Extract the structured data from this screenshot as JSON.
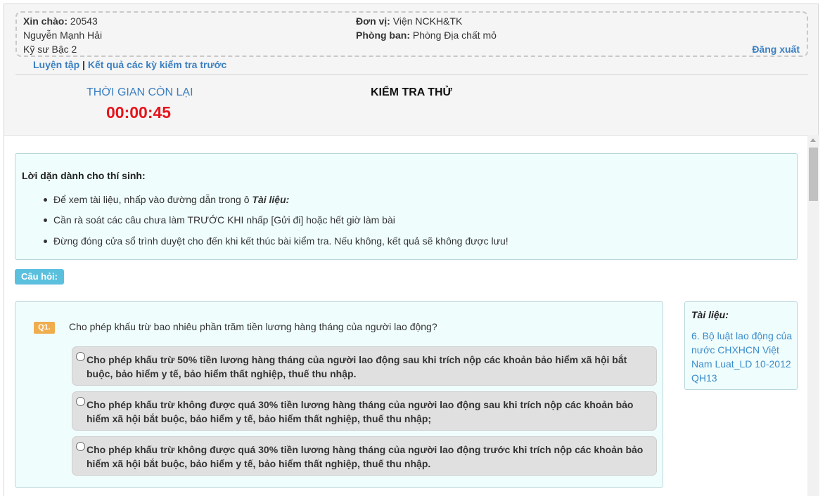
{
  "user": {
    "greeting_label": "Xin chào:",
    "user_id": "20543",
    "full_name": "Nguyễn Mạnh Hải",
    "rank": "Kỹ sư Bậc 2",
    "unit_label": "Đơn vị:",
    "unit_value": "Viện NCKH&TK",
    "department_label": "Phòng ban:",
    "department_value": "Phòng Địa chất mỏ",
    "logout_label": "Đăng xuất"
  },
  "nav": {
    "practice_label": "Luyện tập",
    "separator": "|",
    "results_label": "Kết quả các kỳ kiểm tra trước"
  },
  "timer": {
    "label": "THỜI GIAN CÒN LẠI",
    "value": "00:00:45"
  },
  "exam": {
    "title": "KIỂM TRA THỬ"
  },
  "notice": {
    "title": "Lời dặn dành cho thí sinh:",
    "item1_prefix": "Để xem tài liệu, nhấp vào đường dẫn trong ô ",
    "item1_emphasis": "Tài liệu:",
    "item2": "Cần rà soát các câu chưa làm TRƯỚC KHI nhấp [Gửi đi] hoặc hết giờ làm bài",
    "item3": "Đừng đóng cửa sổ trình duyệt cho đến khi kết thúc bài kiểm tra. Nếu không, kết quả sẽ không được lưu!"
  },
  "questions_label": "Câu hỏi:",
  "question": {
    "number": "Q1.",
    "text": "Cho phép khấu trừ bao nhiêu phần trăm tiền lương hàng tháng của người lao động?",
    "options": [
      "Cho phép khấu trừ 50% tiền lương hàng tháng của người lao động sau khi trích nộp các khoản bảo hiểm xã hội bắt buộc, bảo hiểm y tế, bảo hiểm thất nghiệp, thuế thu nhập.",
      "Cho phép khấu trừ không được quá 30% tiền lương hàng tháng của người lao động sau khi trích nộp các khoản bảo hiểm xã hội bắt buộc, bảo hiểm y tế, bảo hiểm thất nghiệp, thuế thu nhập;",
      "Cho phép khấu trừ không được quá 30% tiền lương hàng tháng của người lao động trước khi trích nộp các khoản bảo hiểm xã hội bắt buộc, bảo hiểm y tế, bảo hiểm thất nghiệp, thuế thu nhập."
    ]
  },
  "documents": {
    "title": "Tài liệu:",
    "link": "6. Bộ luật lao động của nước CHXHCN Việt Nam Luat_LD 10-2012 QH13"
  }
}
